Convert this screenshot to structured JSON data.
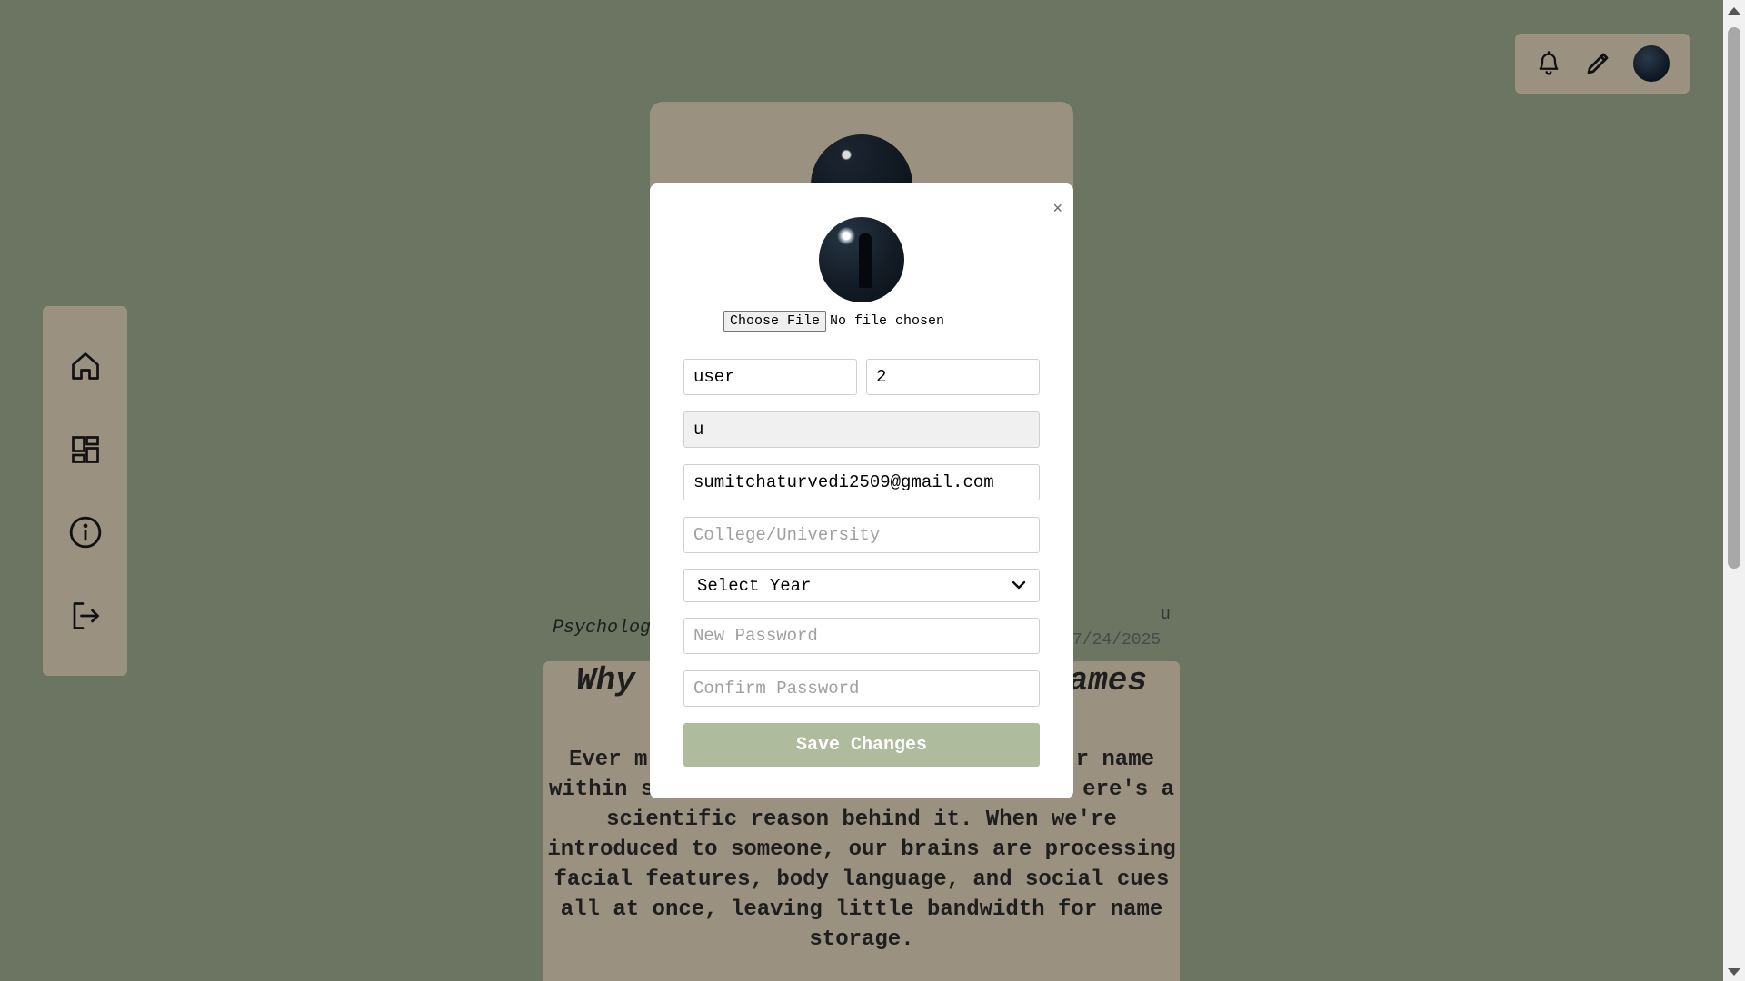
{
  "topbar": {
    "icons": [
      "bell-icon",
      "pencil-icon",
      "avatar"
    ]
  },
  "sidebar": {
    "items": [
      {
        "icon": "home-icon"
      },
      {
        "icon": "dashboard-icon"
      },
      {
        "icon": "info-icon"
      },
      {
        "icon": "logout-icon"
      }
    ]
  },
  "background_post": {
    "category": "Psycholog",
    "author": "u",
    "date": "7/24/2025",
    "title_left": "Why",
    "title_right": "ames",
    "body_lines": [
      {
        "left": "Ever m",
        "right": "r name"
      },
      {
        "left": "within s",
        "right": "ere's a"
      }
    ],
    "body_full": "scientific reason behind it. When we're introduced to someone, our brains are processing facial features, body language, and social cues all at once, leaving little bandwidth for name storage."
  },
  "modal": {
    "close_label": "×",
    "file": {
      "button_label": "Choose File",
      "status": "No file chosen"
    },
    "first_name": "user",
    "last_name": "2",
    "username": "u",
    "email": "sumitchaturvedi2509@gmail.com",
    "college_placeholder": "College/University",
    "year_select": "Select Year",
    "new_password_placeholder": "New Password",
    "confirm_password_placeholder": "Confirm Password",
    "save_label": "Save Changes"
  },
  "colors": {
    "background": "#6b7561",
    "panel": "#9a9180",
    "save_button": "#aebc9d"
  }
}
